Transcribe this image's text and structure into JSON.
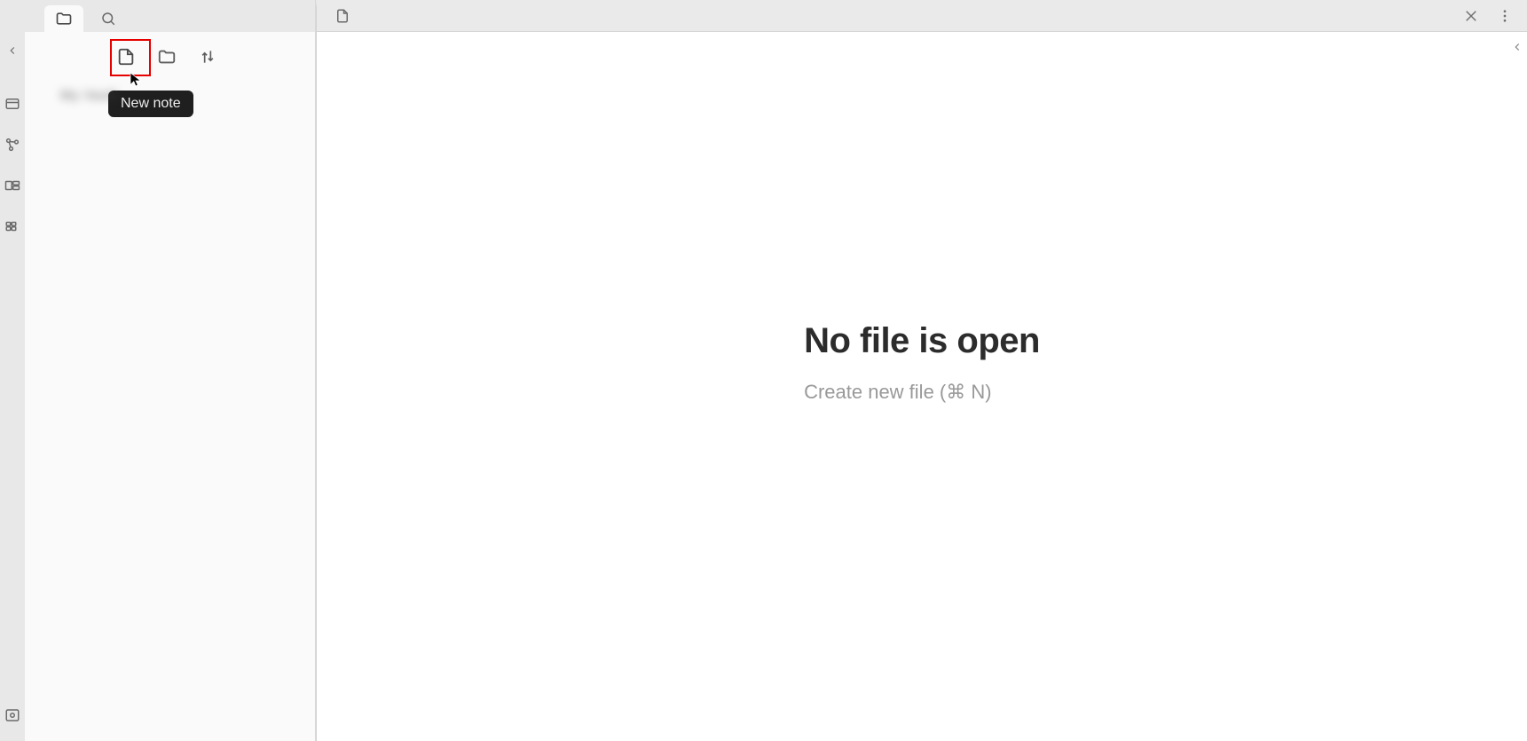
{
  "sidebar": {
    "tabs": {
      "files": "files",
      "search": "search"
    },
    "actions": {
      "new_note_tooltip": "New note",
      "new_folder": "New folder",
      "sort": "Change sort order"
    },
    "vault_name": "My Vault"
  },
  "left_rail": {
    "back": "collapse",
    "quick_switcher": "quick-switcher",
    "graph": "graph-view",
    "canvas": "canvas",
    "command": "command-palette",
    "vault": "open-vault"
  },
  "editor": {
    "tab_icon": "file",
    "close": "close",
    "more": "more"
  },
  "empty": {
    "title": "No file is open",
    "subtitle": "Create new file (⌘ N)"
  }
}
